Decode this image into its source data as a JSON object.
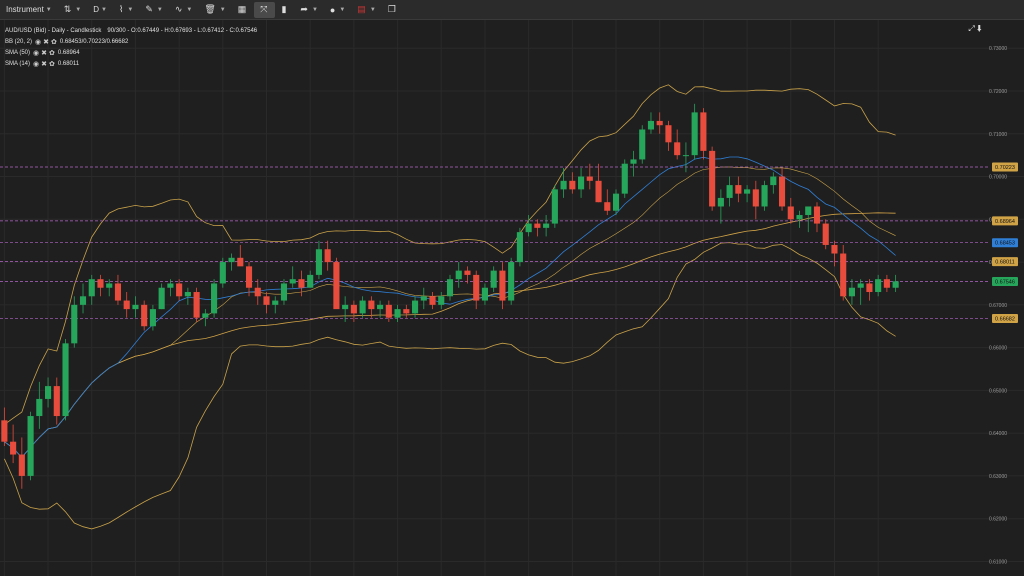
{
  "toolbar": {
    "instrument_label": "Instrument",
    "timeframe_label": "D"
  },
  "legend": {
    "title": "AUD/USD (Bid) - Daily - Candlestick",
    "ohlc": "90/300 - O:0.67449 - H:0.67693 - L:0.67412 - C:0.67546",
    "bb_label": "BB (20, 2)",
    "bb_value": "0.68453/0.70223/0.66682",
    "sma50_label": "SMA (50)",
    "sma50_value": "0.68964",
    "sma14_label": "SMA (14)",
    "sma14_value": "0.68011"
  },
  "colors": {
    "background": "#1f1f1f",
    "up": "#26a65b",
    "down": "#e74c3c",
    "bollinger": "#c9a24a",
    "sma50": "#d1a347",
    "sma14": "#2f7fd6",
    "level_line": "#b567c9",
    "last_price": "#26a65b"
  },
  "chart_data": {
    "type": "candlestick",
    "title": "AUD/USD (Bid) - Daily - Candlestick",
    "ylim": [
      0.6066,
      0.7366
    ],
    "yticks": [
      "0.73000",
      "0.72000",
      "0.71000",
      "0.70000",
      "0.69000",
      "0.68000",
      "0.67000",
      "0.66000",
      "0.65000",
      "0.64000",
      "0.63000",
      "0.62000",
      "0.61000"
    ],
    "grid": true,
    "candles": [
      [
        0.643,
        0.646,
        0.637,
        0.638
      ],
      [
        0.638,
        0.642,
        0.633,
        0.635
      ],
      [
        0.635,
        0.639,
        0.627,
        0.63
      ],
      [
        0.63,
        0.645,
        0.629,
        0.644
      ],
      [
        0.644,
        0.652,
        0.641,
        0.648
      ],
      [
        0.648,
        0.653,
        0.646,
        0.651
      ],
      [
        0.651,
        0.653,
        0.642,
        0.644
      ],
      [
        0.644,
        0.662,
        0.643,
        0.661
      ],
      [
        0.661,
        0.672,
        0.66,
        0.67
      ],
      [
        0.67,
        0.675,
        0.668,
        0.672
      ],
      [
        0.672,
        0.677,
        0.67,
        0.676
      ],
      [
        0.676,
        0.677,
        0.672,
        0.674
      ],
      [
        0.674,
        0.676,
        0.672,
        0.675
      ],
      [
        0.675,
        0.677,
        0.67,
        0.671
      ],
      [
        0.671,
        0.673,
        0.667,
        0.669
      ],
      [
        0.669,
        0.672,
        0.667,
        0.67
      ],
      [
        0.67,
        0.671,
        0.664,
        0.665
      ],
      [
        0.665,
        0.67,
        0.664,
        0.669
      ],
      [
        0.669,
        0.675,
        0.669,
        0.674
      ],
      [
        0.674,
        0.676,
        0.672,
        0.675
      ],
      [
        0.675,
        0.676,
        0.671,
        0.672
      ],
      [
        0.672,
        0.674,
        0.67,
        0.673
      ],
      [
        0.673,
        0.674,
        0.666,
        0.667
      ],
      [
        0.667,
        0.669,
        0.665,
        0.668
      ],
      [
        0.668,
        0.676,
        0.667,
        0.675
      ],
      [
        0.675,
        0.681,
        0.674,
        0.68
      ],
      [
        0.68,
        0.682,
        0.678,
        0.681
      ],
      [
        0.681,
        0.684,
        0.68,
        0.679
      ],
      [
        0.679,
        0.68,
        0.672,
        0.674
      ],
      [
        0.674,
        0.676,
        0.67,
        0.672
      ],
      [
        0.672,
        0.673,
        0.668,
        0.67
      ],
      [
        0.67,
        0.672,
        0.668,
        0.671
      ],
      [
        0.671,
        0.676,
        0.67,
        0.675
      ],
      [
        0.675,
        0.679,
        0.674,
        0.676
      ],
      [
        0.676,
        0.678,
        0.672,
        0.674
      ],
      [
        0.674,
        0.678,
        0.674,
        0.677
      ],
      [
        0.677,
        0.685,
        0.676,
        0.683
      ],
      [
        0.683,
        0.685,
        0.678,
        0.68
      ],
      [
        0.68,
        0.681,
        0.67,
        0.669
      ],
      [
        0.669,
        0.672,
        0.666,
        0.67
      ],
      [
        0.67,
        0.671,
        0.666,
        0.668
      ],
      [
        0.668,
        0.672,
        0.667,
        0.671
      ],
      [
        0.671,
        0.672,
        0.667,
        0.669
      ],
      [
        0.669,
        0.671,
        0.667,
        0.67
      ],
      [
        0.67,
        0.671,
        0.666,
        0.667
      ],
      [
        0.667,
        0.67,
        0.666,
        0.669
      ],
      [
        0.669,
        0.67,
        0.667,
        0.668
      ],
      [
        0.668,
        0.672,
        0.667,
        0.671
      ],
      [
        0.671,
        0.674,
        0.669,
        0.672
      ],
      [
        0.672,
        0.673,
        0.669,
        0.67
      ],
      [
        0.67,
        0.673,
        0.669,
        0.672
      ],
      [
        0.672,
        0.677,
        0.671,
        0.676
      ],
      [
        0.676,
        0.68,
        0.674,
        0.678
      ],
      [
        0.678,
        0.679,
        0.675,
        0.677
      ],
      [
        0.677,
        0.678,
        0.669,
        0.671
      ],
      [
        0.671,
        0.675,
        0.67,
        0.674
      ],
      [
        0.674,
        0.679,
        0.673,
        0.678
      ],
      [
        0.678,
        0.68,
        0.669,
        0.671
      ],
      [
        0.671,
        0.681,
        0.67,
        0.68
      ],
      [
        0.68,
        0.688,
        0.679,
        0.687
      ],
      [
        0.687,
        0.691,
        0.686,
        0.689
      ],
      [
        0.689,
        0.69,
        0.686,
        0.688
      ],
      [
        0.688,
        0.691,
        0.686,
        0.689
      ],
      [
        0.689,
        0.698,
        0.688,
        0.697
      ],
      [
        0.697,
        0.702,
        0.695,
        0.699
      ],
      [
        0.699,
        0.701,
        0.696,
        0.697
      ],
      [
        0.697,
        0.702,
        0.695,
        0.7
      ],
      [
        0.7,
        0.703,
        0.697,
        0.699
      ],
      [
        0.699,
        0.703,
        0.694,
        0.694
      ],
      [
        0.694,
        0.697,
        0.691,
        0.692
      ],
      [
        0.692,
        0.697,
        0.691,
        0.696
      ],
      [
        0.696,
        0.704,
        0.695,
        0.703
      ],
      [
        0.703,
        0.706,
        0.7,
        0.704
      ],
      [
        0.704,
        0.712,
        0.703,
        0.711
      ],
      [
        0.711,
        0.715,
        0.71,
        0.713
      ],
      [
        0.713,
        0.715,
        0.71,
        0.712
      ],
      [
        0.712,
        0.713,
        0.706,
        0.708
      ],
      [
        0.708,
        0.711,
        0.704,
        0.705
      ],
      [
        0.705,
        0.708,
        0.701,
        0.705
      ],
      [
        0.705,
        0.717,
        0.704,
        0.715
      ],
      [
        0.715,
        0.716,
        0.704,
        0.706
      ],
      [
        0.706,
        0.707,
        0.692,
        0.693
      ],
      [
        0.693,
        0.697,
        0.689,
        0.695
      ],
      [
        0.695,
        0.7,
        0.693,
        0.698
      ],
      [
        0.698,
        0.7,
        0.694,
        0.696
      ],
      [
        0.696,
        0.698,
        0.694,
        0.697
      ],
      [
        0.697,
        0.699,
        0.69,
        0.693
      ],
      [
        0.693,
        0.699,
        0.692,
        0.698
      ],
      [
        0.698,
        0.701,
        0.696,
        0.7
      ],
      [
        0.7,
        0.702,
        0.692,
        0.693
      ],
      [
        0.693,
        0.695,
        0.689,
        0.69
      ],
      [
        0.69,
        0.692,
        0.688,
        0.691
      ],
      [
        0.691,
        0.692,
        0.687,
        0.693
      ],
      [
        0.693,
        0.694,
        0.687,
        0.689
      ],
      [
        0.689,
        0.69,
        0.683,
        0.684
      ],
      [
        0.684,
        0.685,
        0.679,
        0.682
      ],
      [
        0.682,
        0.684,
        0.671,
        0.672
      ],
      [
        0.672,
        0.676,
        0.67,
        0.674
      ],
      [
        0.674,
        0.676,
        0.67,
        0.675
      ],
      [
        0.675,
        0.676,
        0.671,
        0.673
      ],
      [
        0.673,
        0.677,
        0.672,
        0.676
      ],
      [
        0.676,
        0.677,
        0.673,
        0.674
      ],
      [
        0.674,
        0.677,
        0.673,
        0.6755
      ]
    ],
    "levels": [
      {
        "value": 0.70223,
        "label": "0.70223",
        "color": "#d1a347"
      },
      {
        "value": 0.68964,
        "label": "0.68964",
        "color": "#d1a347"
      },
      {
        "value": 0.68453,
        "label": "0.68453",
        "color": "#2f7fd6"
      },
      {
        "value": 0.68011,
        "label": "0.68011",
        "color": "#d1a347"
      },
      {
        "value": 0.67546,
        "label": "0.67546",
        "color": "#26a65b"
      },
      {
        "value": 0.66682,
        "label": "0.66682",
        "color": "#d1a347"
      }
    ]
  }
}
